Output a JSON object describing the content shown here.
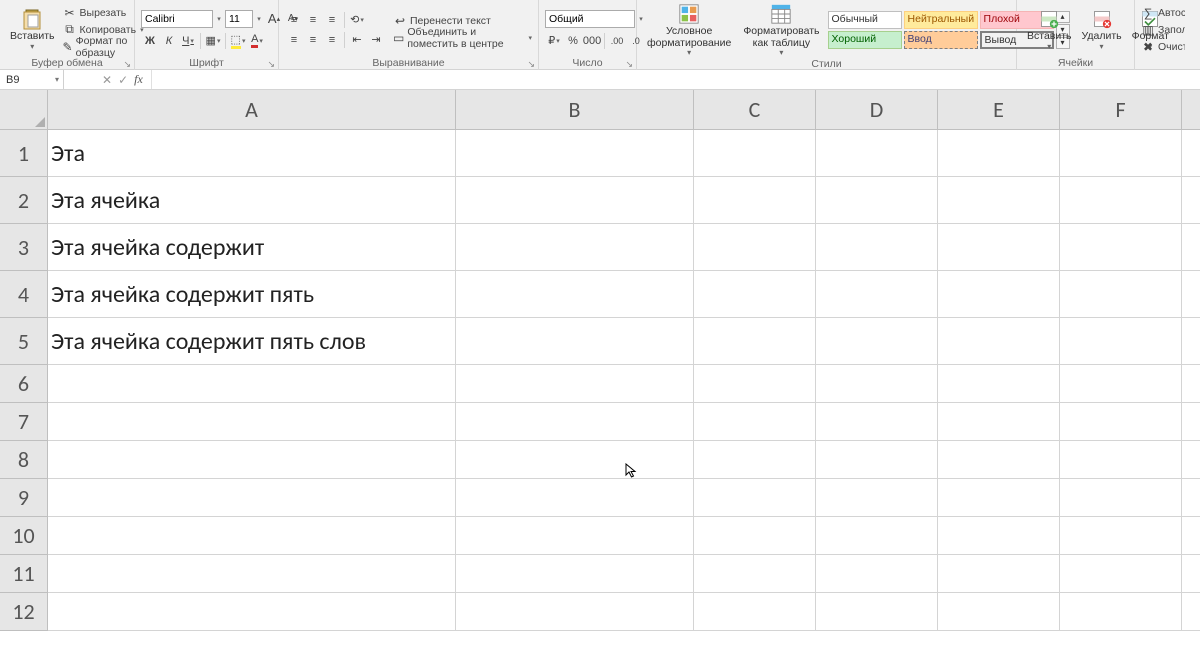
{
  "ribbon": {
    "clipboard": {
      "paste": "Вставить",
      "cut": "Вырезать",
      "copy": "Копировать",
      "format_painter": "Формат по образцу",
      "group": "Буфер обмена"
    },
    "font": {
      "name": "Calibri",
      "size": "11",
      "bold": "Ж",
      "italic": "К",
      "underline": "Ч",
      "grow": "A",
      "shrink": "A",
      "group": "Шрифт"
    },
    "alignment": {
      "wrap": "Перенести текст",
      "merge": "Объединить и поместить в центре",
      "group": "Выравнивание"
    },
    "number": {
      "format": "Общий",
      "percent": "%",
      "comma": "000",
      "inc_dec": "←0",
      "dec_dec": "→0",
      "group": "Число"
    },
    "styles": {
      "conditional": "Условное\nформатирование",
      "as_table": "Форматировать\nкак таблицу",
      "normal": "Обычный",
      "neutral": "Нейтральный",
      "bad": "Плохой",
      "good": "Хороший",
      "input": "Ввод",
      "output": "Вывод",
      "group": "Стили"
    },
    "cells": {
      "insert": "Вставить",
      "delete": "Удалить",
      "format": "Формат",
      "group": "Ячейки"
    },
    "editing": {
      "autosum": "Автосу",
      "fill": "Заполн",
      "clear": "Очисти"
    }
  },
  "formula_bar": {
    "name_box": "B9",
    "formula": ""
  },
  "columns": {
    "A": "A",
    "B": "B",
    "C": "C",
    "D": "D",
    "E": "E",
    "F": "F"
  },
  "rows_content": {
    "1": "Эта",
    "2": "Эта ячейка",
    "3": "Эта ячейка содержит",
    "4": "Эта ячейка содержит пять",
    "5": "Эта ячейка содержит пять слов"
  },
  "row_numbers": [
    "1",
    "2",
    "3",
    "4",
    "5",
    "6",
    "7",
    "8",
    "9",
    "10",
    "11",
    "12"
  ]
}
